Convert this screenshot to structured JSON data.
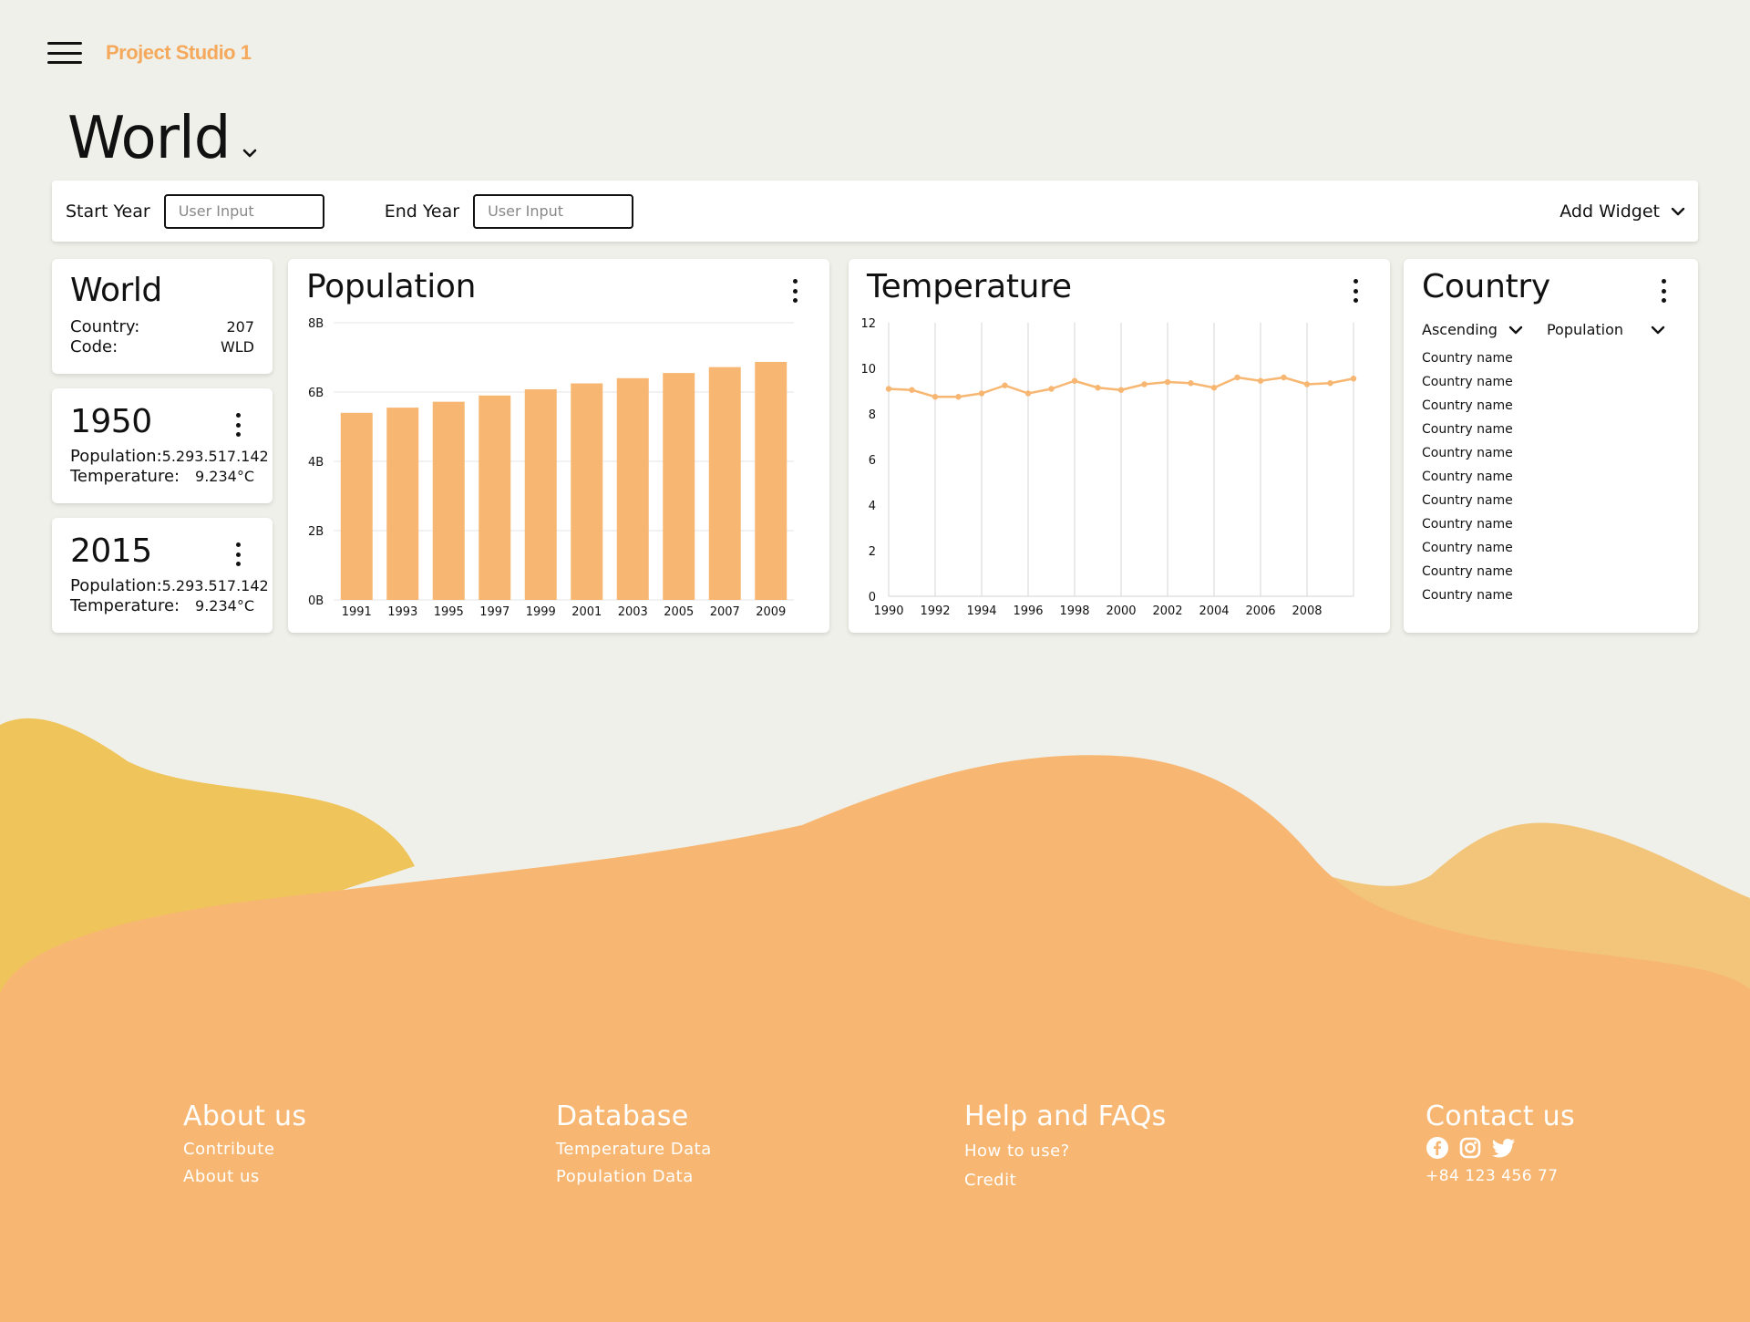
{
  "header": {
    "brand": "Project Studio 1",
    "menu_icon": "hamburger-icon"
  },
  "page": {
    "title": "World"
  },
  "filters": {
    "start_label": "Start Year",
    "start_placeholder": "User Input",
    "end_label": "End Year",
    "end_placeholder": "User Input",
    "add_widget_label": "Add Widget"
  },
  "summary": {
    "title": "World",
    "country_label": "Country:",
    "country_value": "207",
    "code_label": "Code:",
    "code_value": "WLD"
  },
  "year_cards": [
    {
      "year": "1950",
      "population_label": "Population:",
      "population_value": "5.293.517.142",
      "temperature_label": "Temperature:",
      "temperature_value": "9.234°C"
    },
    {
      "year": "2015",
      "population_label": "Population:",
      "population_value": "5.293.517.142",
      "temperature_label": "Temperature:",
      "temperature_value": "9.234°C"
    }
  ],
  "population_widget": {
    "title": "Population"
  },
  "temperature_widget": {
    "title": "Temperature"
  },
  "country_widget": {
    "title": "Country",
    "sort_order": "Ascending",
    "sort_field": "Population",
    "items": [
      "Country name",
      "Country name",
      "Country name",
      "Country name",
      "Country name",
      "Country name",
      "Country name",
      "Country name",
      "Country name",
      "Country name",
      "Country name"
    ]
  },
  "chart_data": [
    {
      "type": "bar",
      "title": "Population",
      "categories": [
        "1991",
        "1993",
        "1995",
        "1997",
        "1999",
        "2001",
        "2003",
        "2005",
        "2007",
        "2009"
      ],
      "values": [
        5.4,
        5.55,
        5.72,
        5.9,
        6.08,
        6.25,
        6.4,
        6.55,
        6.72,
        6.87
      ],
      "y_ticks": [
        "0B",
        "2B",
        "4B",
        "6B",
        "8B"
      ],
      "ylim": [
        0,
        8
      ],
      "color": "#f7b772"
    },
    {
      "type": "line",
      "title": "Temperature",
      "x": [
        1990,
        1991,
        1992,
        1993,
        1994,
        1995,
        1996,
        1997,
        1998,
        1999,
        2000,
        2001,
        2002,
        2003,
        2004,
        2005,
        2006,
        2007,
        2008,
        2009
      ],
      "x_tick_labels": [
        "1990",
        "1992",
        "1994",
        "1996",
        "1998",
        "2000",
        "2002",
        "2004",
        "2006",
        "2008"
      ],
      "values": [
        9.1,
        9.05,
        8.75,
        8.75,
        8.9,
        9.25,
        8.9,
        9.1,
        9.45,
        9.15,
        9.05,
        9.3,
        9.4,
        9.35,
        9.15,
        9.6,
        9.45,
        9.6,
        9.3,
        9.35,
        9.55
      ],
      "y_ticks": [
        "0",
        "2",
        "4",
        "6",
        "8",
        "10",
        "12"
      ],
      "ylim": [
        0,
        12
      ],
      "color": "#f7b772"
    }
  ],
  "footer": {
    "about": {
      "title": "About us",
      "links": [
        "Contribute",
        "About us"
      ]
    },
    "database": {
      "title": "Database",
      "links": [
        "Temperature Data",
        "Population Data"
      ]
    },
    "help": {
      "title": "Help and FAQs",
      "links": [
        "How to use?",
        "Credit"
      ]
    },
    "contact": {
      "title": "Contact us",
      "phone": "+84 123 456 77",
      "icons": [
        "facebook-icon",
        "instagram-icon",
        "twitter-icon"
      ]
    }
  },
  "colors": {
    "accent": "#f7b772",
    "brand": "#f5a95c",
    "background": "#f0f0ea",
    "wave_yellow": "#efc45a",
    "wave_light": "#f2c57a"
  }
}
